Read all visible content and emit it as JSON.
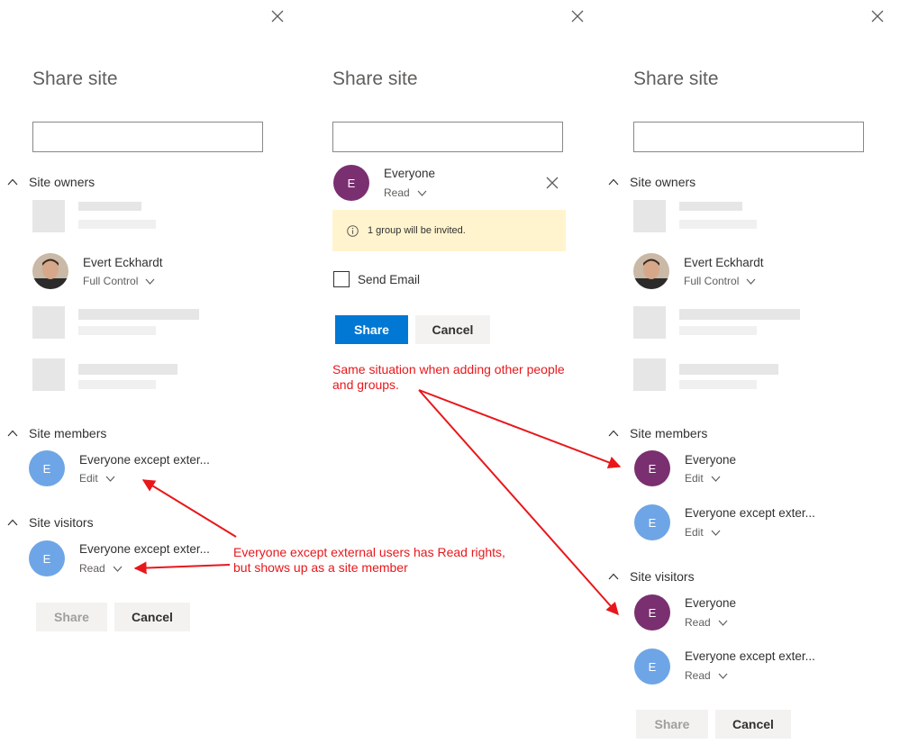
{
  "panel1": {
    "title": "Share site",
    "owners_label": "Site owners",
    "owner_named": {
      "name": "Evert Eckhardt",
      "permission": "Full Control"
    },
    "members_label": "Site members",
    "members": [
      {
        "initial": "E",
        "name": "Everyone except exter...",
        "permission": "Edit"
      }
    ],
    "visitors_label": "Site visitors",
    "visitors": [
      {
        "initial": "E",
        "name": "Everyone except exter...",
        "permission": "Read"
      }
    ],
    "share_label": "Share",
    "cancel_label": "Cancel"
  },
  "panel2": {
    "title": "Share site",
    "invitee": {
      "initial": "E",
      "name": "Everyone",
      "permission": "Read"
    },
    "notice": "1 group will be invited.",
    "send_email_label": "Send Email",
    "share_label": "Share",
    "cancel_label": "Cancel"
  },
  "panel3": {
    "title": "Share site",
    "owners_label": "Site owners",
    "owner_named": {
      "name": "Evert Eckhardt",
      "permission": "Full Control"
    },
    "members_label": "Site members",
    "members": [
      {
        "initial": "E",
        "name": "Everyone",
        "permission": "Edit"
      },
      {
        "initial": "E",
        "name": "Everyone except exter...",
        "permission": "Edit"
      }
    ],
    "visitors_label": "Site visitors",
    "visitors": [
      {
        "initial": "E",
        "name": "Everyone",
        "permission": "Read"
      },
      {
        "initial": "E",
        "name": "Everyone except exter...",
        "permission": "Read"
      }
    ],
    "share_label": "Share",
    "cancel_label": "Cancel"
  },
  "annotations": {
    "top": [
      "Same situation when adding other people",
      "and groups."
    ],
    "bottom": [
      "Everyone except external users has Read rights,",
      "but shows up as a site member"
    ]
  },
  "colors": {
    "accent": "#0078d4",
    "annotation": "#e8171b",
    "avatar_blue": "#6ea5e6",
    "avatar_purple": "#7a2f70",
    "notice_bg": "#fff4ce"
  },
  "icons": {
    "close": "close-icon",
    "collapse": "chevron-up-icon",
    "dropdown": "chevron-down-icon",
    "info": "info-icon"
  }
}
